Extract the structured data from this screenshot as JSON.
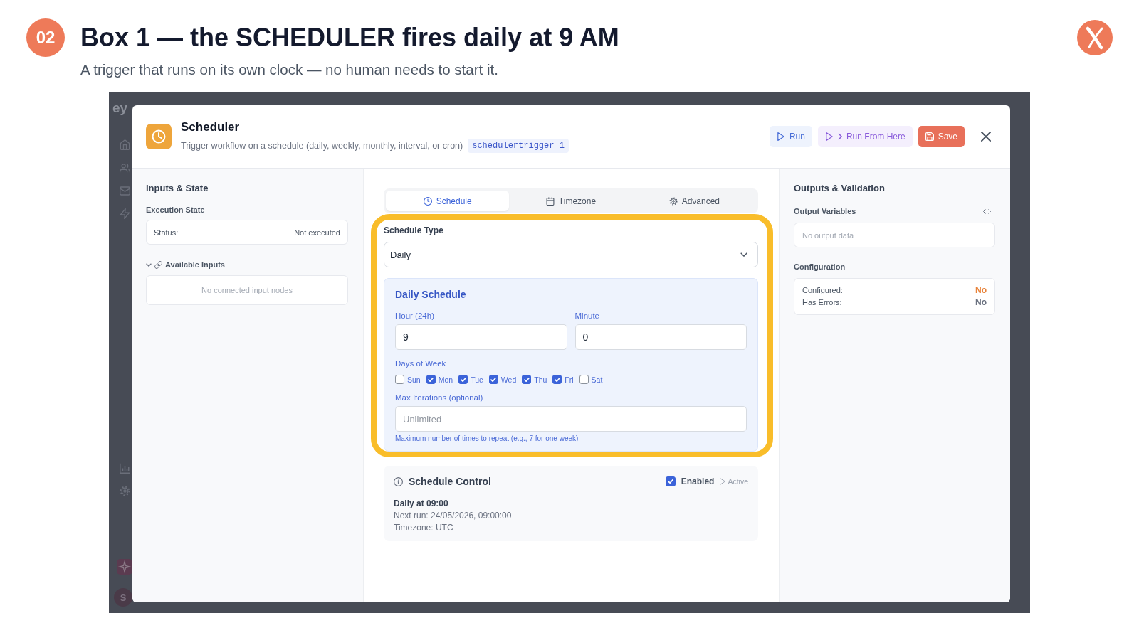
{
  "slide": {
    "number": "02",
    "title": "Box 1 — the SCHEDULER fires daily at 9 AM",
    "subtitle": "A trigger that runs on its own clock — no human needs to start it."
  },
  "backdrop": {
    "brand": "ey",
    "avatar_initial": "S"
  },
  "dialog": {
    "title": "Scheduler",
    "description": "Trigger workflow on a schedule (daily, weekly, monthly, interval, or cron)",
    "node_id": "schedulertrigger_1",
    "actions": [
      {
        "label": "Run",
        "kind": "run"
      },
      {
        "label": "Run From Here",
        "kind": "runfrom"
      },
      {
        "label": "Save",
        "kind": "save"
      }
    ]
  },
  "inputs_panel": {
    "title": "Inputs & State",
    "execution_state": {
      "label": "Execution State",
      "status_label": "Status:",
      "status_value": "Not executed"
    },
    "available_inputs": {
      "label": "Available Inputs",
      "expanded": true,
      "empty_text": "No connected input nodes"
    }
  },
  "tabs": [
    {
      "label": "Schedule",
      "selected": true
    },
    {
      "label": "Timezone",
      "selected": false
    },
    {
      "label": "Advanced",
      "selected": false
    }
  ],
  "schedule_form": {
    "highlighted": true,
    "type_label": "Schedule Type",
    "type_value": "Daily",
    "daily": {
      "title": "Daily Schedule",
      "hour": {
        "label": "Hour (24h)",
        "value": "9"
      },
      "minute": {
        "label": "Minute",
        "value": "0"
      },
      "days_label": "Days of Week",
      "days": [
        {
          "label": "Sun",
          "checked": false
        },
        {
          "label": "Mon",
          "checked": true
        },
        {
          "label": "Tue",
          "checked": true
        },
        {
          "label": "Wed",
          "checked": true
        },
        {
          "label": "Thu",
          "checked": true
        },
        {
          "label": "Fri",
          "checked": true
        },
        {
          "label": "Sat",
          "checked": false
        }
      ],
      "max_iterations": {
        "label": "Max Iterations (optional)",
        "placeholder": "Unlimited",
        "help": "Maximum number of times to repeat (e.g., 7 for one week)"
      }
    }
  },
  "schedule_control": {
    "title": "Schedule Control",
    "enabled": {
      "label": "Enabled",
      "checked": true
    },
    "status": "Active",
    "summary": "Daily at 09:00",
    "next_run": "Next run: 24/05/2026, 09:00:00",
    "timezone": "Timezone: UTC"
  },
  "outputs_panel": {
    "title": "Outputs & Validation",
    "output_variables": {
      "label": "Output Variables",
      "empty_text": "No output data"
    },
    "configuration": {
      "label": "Configuration",
      "rows": [
        {
          "label": "Configured:",
          "value": "No",
          "color": "#e8833a"
        },
        {
          "label": "Has Errors:",
          "value": "No",
          "color": "#6b7280"
        }
      ]
    }
  }
}
